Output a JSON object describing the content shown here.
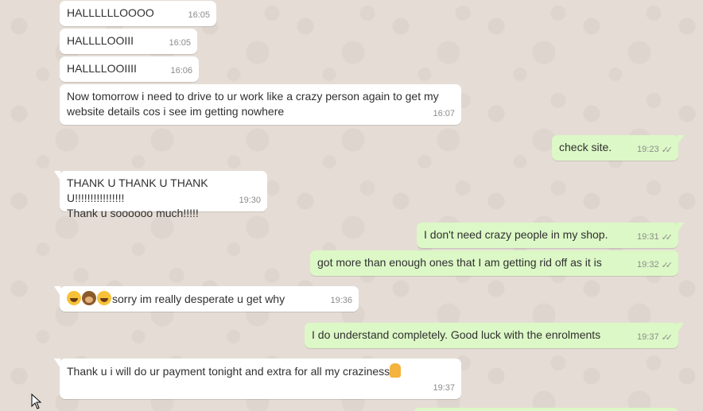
{
  "chat": {
    "messages": [
      {
        "dir": "in",
        "text": "HALLLLLLOOOO",
        "time": "16:05"
      },
      {
        "dir": "in",
        "text": "HALLLLOOIII",
        "time": "16:05"
      },
      {
        "dir": "in",
        "text": "HALLLLOOIIII",
        "time": "16:06"
      },
      {
        "dir": "in",
        "text": "Now tomorrow i need to drive to ur work like a crazy person again to get my website details cos i see im getting nowhere",
        "time": "16:07"
      },
      {
        "dir": "out",
        "text": "check site.",
        "time": "19:23",
        "status": "read"
      },
      {
        "dir": "in",
        "text": "THANK U THANK U THANK U!!!!!!!!!!!!!!!!",
        "text2": "Thank u soooooo much!!!!!",
        "time": "19:30"
      },
      {
        "dir": "out",
        "text": "I don't need crazy people in my shop.",
        "time": "19:31",
        "status": "read"
      },
      {
        "dir": "out",
        "text": "got more than enough ones that I am getting rid off as it is",
        "time": "19:32",
        "status": "read"
      },
      {
        "dir": "in",
        "text": "sorry im really desperate u get why",
        "emojis": [
          "laugh-cry-emoji",
          "see-no-evil-monkey-emoji",
          "laugh-cry-emoji"
        ],
        "time": "19:36"
      },
      {
        "dir": "out",
        "text": "I do understand completely. Good luck with the enrolments",
        "time": "19:37",
        "status": "read"
      },
      {
        "dir": "in",
        "text": "Thank u i will do ur payment tonight and extra for all my craziness",
        "emoji_end": "folded-hands-emoji",
        "time": "19:37"
      }
    ],
    "read_ticks": "✓✓"
  },
  "colors": {
    "wallpaper": "#e5ddd5",
    "incoming_bubble": "#ffffff",
    "outgoing_bubble": "#dcf8c6",
    "meta_text": "#8c8c8c"
  }
}
